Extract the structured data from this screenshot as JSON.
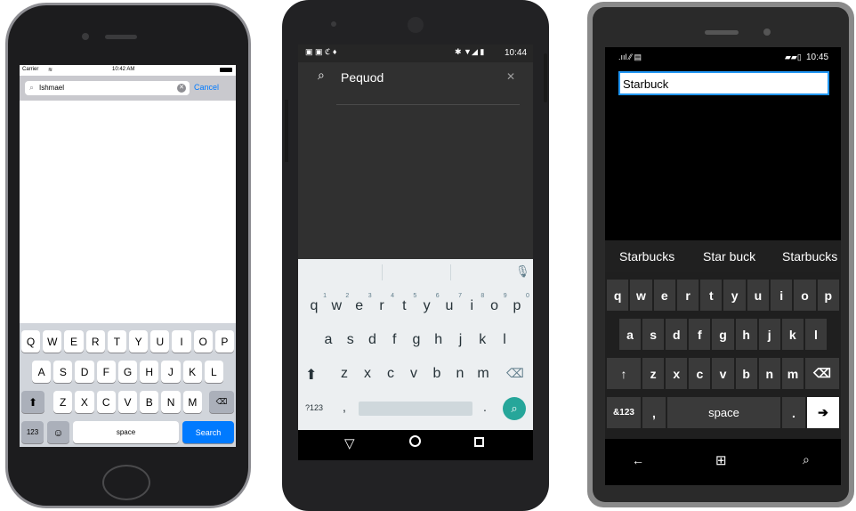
{
  "ios": {
    "carrier": "Carrier",
    "time": "10:42 AM",
    "search_text": "Ishmael",
    "cancel_label": "Cancel",
    "keyboard": {
      "row1": [
        "Q",
        "W",
        "E",
        "R",
        "T",
        "Y",
        "U",
        "I",
        "O",
        "P"
      ],
      "row2": [
        "A",
        "S",
        "D",
        "F",
        "G",
        "H",
        "J",
        "K",
        "L"
      ],
      "row3": [
        "Z",
        "X",
        "C",
        "V",
        "B",
        "N",
        "M"
      ],
      "numbers_label": "123",
      "space_label": "space",
      "search_label": "Search"
    }
  },
  "android": {
    "time": "10:44",
    "search_text": "Pequod",
    "keyboard": {
      "row1": [
        "q",
        "w",
        "e",
        "r",
        "t",
        "y",
        "u",
        "i",
        "o",
        "p"
      ],
      "row1_hints": [
        "1",
        "2",
        "3",
        "4",
        "5",
        "6",
        "7",
        "8",
        "9",
        "0"
      ],
      "row2": [
        "a",
        "s",
        "d",
        "f",
        "g",
        "h",
        "j",
        "k",
        "l"
      ],
      "row3": [
        "z",
        "x",
        "c",
        "v",
        "b",
        "n",
        "m"
      ],
      "symbols_label": "?123",
      "comma": ",",
      "period": "."
    }
  },
  "windows": {
    "time": "10:45",
    "search_text": "Starbuck",
    "suggestions": [
      "Starbucks",
      "Star buck",
      "Starbucks"
    ],
    "keyboard": {
      "row1": [
        "q",
        "w",
        "e",
        "r",
        "t",
        "y",
        "u",
        "i",
        "o",
        "p"
      ],
      "row2": [
        "a",
        "s",
        "d",
        "f",
        "g",
        "h",
        "j",
        "k",
        "l"
      ],
      "row3": [
        "z",
        "x",
        "c",
        "v",
        "b",
        "n",
        "m"
      ],
      "symbols_label": "&123",
      "comma": ",",
      "space_label": "space",
      "period": ".",
      "enter": "➔"
    }
  }
}
